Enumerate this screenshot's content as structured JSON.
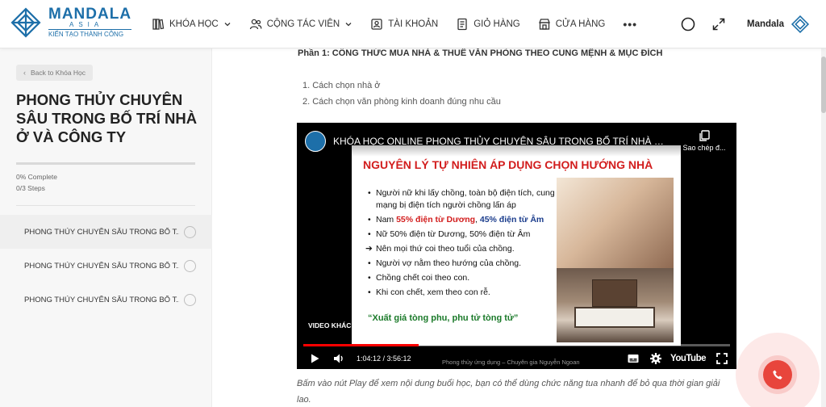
{
  "brand": {
    "name": "MANDALA",
    "sub": "ASIA",
    "tagline": "KIẾN TẠO THÀNH CÔNG",
    "color": "#1d6fa9"
  },
  "nav": {
    "items": [
      {
        "label": "KHÓA HỌC",
        "icon": "books-icon",
        "has_dropdown": true
      },
      {
        "label": "CỘNG TÁC VIÊN",
        "icon": "users-icon",
        "has_dropdown": true
      },
      {
        "label": "TÀI KHOẢN",
        "icon": "account-icon",
        "has_dropdown": false
      },
      {
        "label": "GIỎ HÀNG",
        "icon": "cart-doc-icon",
        "has_dropdown": false
      },
      {
        "label": "CỬA HÀNG",
        "icon": "store-icon",
        "has_dropdown": false
      }
    ],
    "more_label": "•••"
  },
  "header_right": {
    "icons": [
      "dark-mode-icon",
      "expand-icon"
    ],
    "user_name": "Mandala"
  },
  "sidebar": {
    "back_label": "Back to Khóa Học",
    "course_title": "PHONG THỦY CHUYÊN SÂU TRONG BỐ TRÍ NHÀ Ở VÀ CÔNG TY",
    "progress_percent": 0,
    "progress_label": "0% Complete",
    "steps_label": "0/3 Steps",
    "lessons": [
      {
        "label": "PHONG THỦY CHUYÊN SÂU TRONG BỐ T...",
        "active": true
      },
      {
        "label": "PHONG THỦY CHUYÊN SÂU TRONG BỐ T...",
        "active": false
      },
      {
        "label": "PHONG THỦY CHUYÊN SÂU TRONG BỐ T...",
        "active": false
      }
    ]
  },
  "main": {
    "part_title": "Phần 1: CÔNG THỨC MUA NHÀ & THUÊ VĂN PHÒNG THEO CUNG MỆNH & MỤC ĐÍCH",
    "toc": [
      "1. Cách chọn nhà ở",
      "2. Cách chọn văn phòng kinh doanh đúng nhu cầu"
    ],
    "video": {
      "title": "KHÓA HỌC ONLINE PHONG THỦY CHUYÊN SÂU TRONG BỐ TRÍ NHÀ Ở...",
      "copy_label": "Sao chép đ...",
      "other_videos_label": "VIDEO KHÁC",
      "time_current": "1:04:12",
      "time_total": "3:56:12",
      "time_display": "1:04:12 / 3:56:12",
      "progress_fraction": 0.27,
      "bottom_caption": "Phong thủy ứng dụng – Chuyên gia Nguyễn Ngoan",
      "youtube_label": "YouTube",
      "slide": {
        "title": "NGUYÊN LÝ TỰ NHIÊN ÁP DỤNG CHỌN HƯỚNG NHÀ",
        "bullets": [
          "Người nữ khi lấy chồng, toàn bộ điện tích, cung mạng bị điện tích người chồng lấn áp",
          "Nam 55% điện từ Dương, 45% điện từ Âm",
          "Nữ 50% điện từ Dương, 50% điện từ Âm",
          "Nên mọi thứ coi theo tuổi của chồng.",
          "Người vợ nằm theo hướng của chồng.",
          "Chồng chết coi theo con.",
          "Khi con chết, xem theo con rễ."
        ],
        "bullet2_parts": {
          "a": "Nam ",
          "b": "55% điện từ Dương",
          "c": ", ",
          "d": "45% điện từ Âm"
        },
        "quote": "“Xuất giá tòng phu, phu tử tòng tử”"
      }
    },
    "caption_note": "Bấm vào nút Play để xem nội dung buổi học, bạn có thể dùng chức năng tua nhanh để bỏ qua thời gian giải lao."
  },
  "floating": {
    "call_icon": "phone-icon",
    "call_color": "#e8453c"
  }
}
